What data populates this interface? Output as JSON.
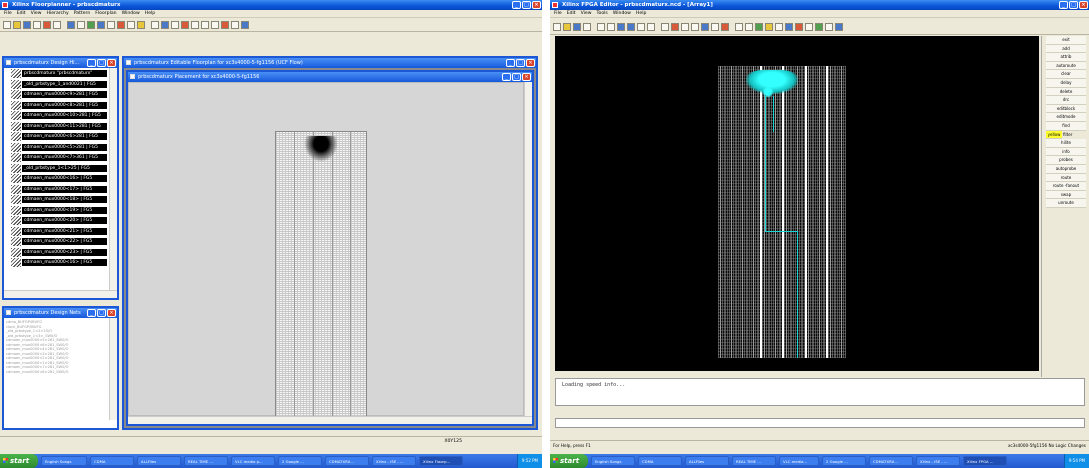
{
  "left_window": {
    "title": "Xilinx Floorplanner - prbscdmaturx",
    "menu": [
      "File",
      "Edit",
      "View",
      "Hierarchy",
      "Pattern",
      "Floorplan",
      "Window",
      "Help"
    ],
    "design_hierarchy": {
      "title": "prbscdmaturx Design Hi...",
      "items": [
        "prbscdmaturx \"prbscdmaturx\"",
        "_old_prbstype_1_and0021 | FG5",
        "cdmaen_mux0000<9>281 | FG5",
        "cdmaen_mux0000<8>281 | FG5",
        "cdmaen_mux0000<10>281 | FG5",
        "cdmaen_mux0000<11>281 | FG5",
        "cdmaen_mux0000<6>281 | FG5",
        "cdmaen_mux0000<5>281 | FG5",
        "cdmaen_mux0000<7>361 | FG5",
        "_old_prbstype_1<1>25 | FG5",
        "cdmaen_mux0000<16> | FG5",
        "cdmaen_mux0000<17> | FG5",
        "cdmaen_mux0000<18> | FG5",
        "cdmaen_mux0000<19> | FG5",
        "cdmaen_mux0000<20> | FG5",
        "cdmaen_mux0000<21> | FG5",
        "cdmaen_mux0000<22> | FG5",
        "cdmaen_mux0000<23> | FG5",
        "cdmaen_mux0000<16> | FG5"
      ]
    },
    "design_nets": {
      "title": "prbscdmaturx Design Nets",
      "items": [
        "cdma_BUFGP/IBUFG",
        "clock_BUFGP/IBUFG",
        "_old_prbstype_1<2>25/O",
        "_old_prbstype_1<3>_SW0/O",
        "cdmaen_mux0000<5>281_SW0/O",
        "cdmaen_mux0000<6>281_SW0/O",
        "cdmaen_mux0000<4>281_SW0/O",
        "cdmaen_mux0000<3>281_SW0/O",
        "cdmaen_mux0000<2>281_SW0/O",
        "cdmaen_mux0000<1>281_SW0/O",
        "cdmaen_mux0000<7>281_SW0/O",
        "cdmaen_mux0000<8>281_SW0/O"
      ]
    },
    "editable_window": {
      "title": "prbscdmaturx Editable Floorplan for xc3s4000-5-fg1156 (UCF Flow)"
    },
    "placement_window": {
      "title": "prbscdmaturx Placement for xc3s4000-5-fg1156"
    },
    "status_coord": "X0Y125",
    "taskbar": {
      "start": "start",
      "items": [
        "English Songs",
        "CDMA",
        "ALLFiles",
        "REAL TIME ...",
        "VLC media p...",
        "2 Google ...",
        "CDMATXRX...",
        "Xilinx - ISE - ...",
        "Xilinx Floorp..."
      ],
      "clock": "9:52 PM"
    }
  },
  "right_window": {
    "title": "Xilinx FPGA Editor - prbscdmaturx.ncd - [Array1]",
    "menu": [
      "File",
      "Edit",
      "View",
      "Tools",
      "Window",
      "Help"
    ],
    "commands": [
      "exit",
      "add",
      "attrib",
      "autoroute",
      "clear",
      "delay",
      "delete",
      "drc",
      "editblock",
      "editmode",
      "find",
      "hilite",
      "info",
      "probes",
      "autoprobe",
      "route",
      "route -fanout",
      "swap",
      "unroute"
    ],
    "color_select": "yellow",
    "filter_label": "filter",
    "console_text": "Loading speed info...",
    "status_left": "For Help, press F1",
    "status_right": "xc3s4000-5fg1156  No Logic Changes",
    "taskbar": {
      "start": "start",
      "items": [
        "English Songs",
        "CDMA",
        "ALLFiles",
        "REAL TIME ...",
        "VLC media...",
        "2 Google ...",
        "CDMATXRX...",
        "Xilinx - ISE - ...",
        "Xilinx FPGA ..."
      ],
      "clock": "9:54 PM"
    }
  }
}
